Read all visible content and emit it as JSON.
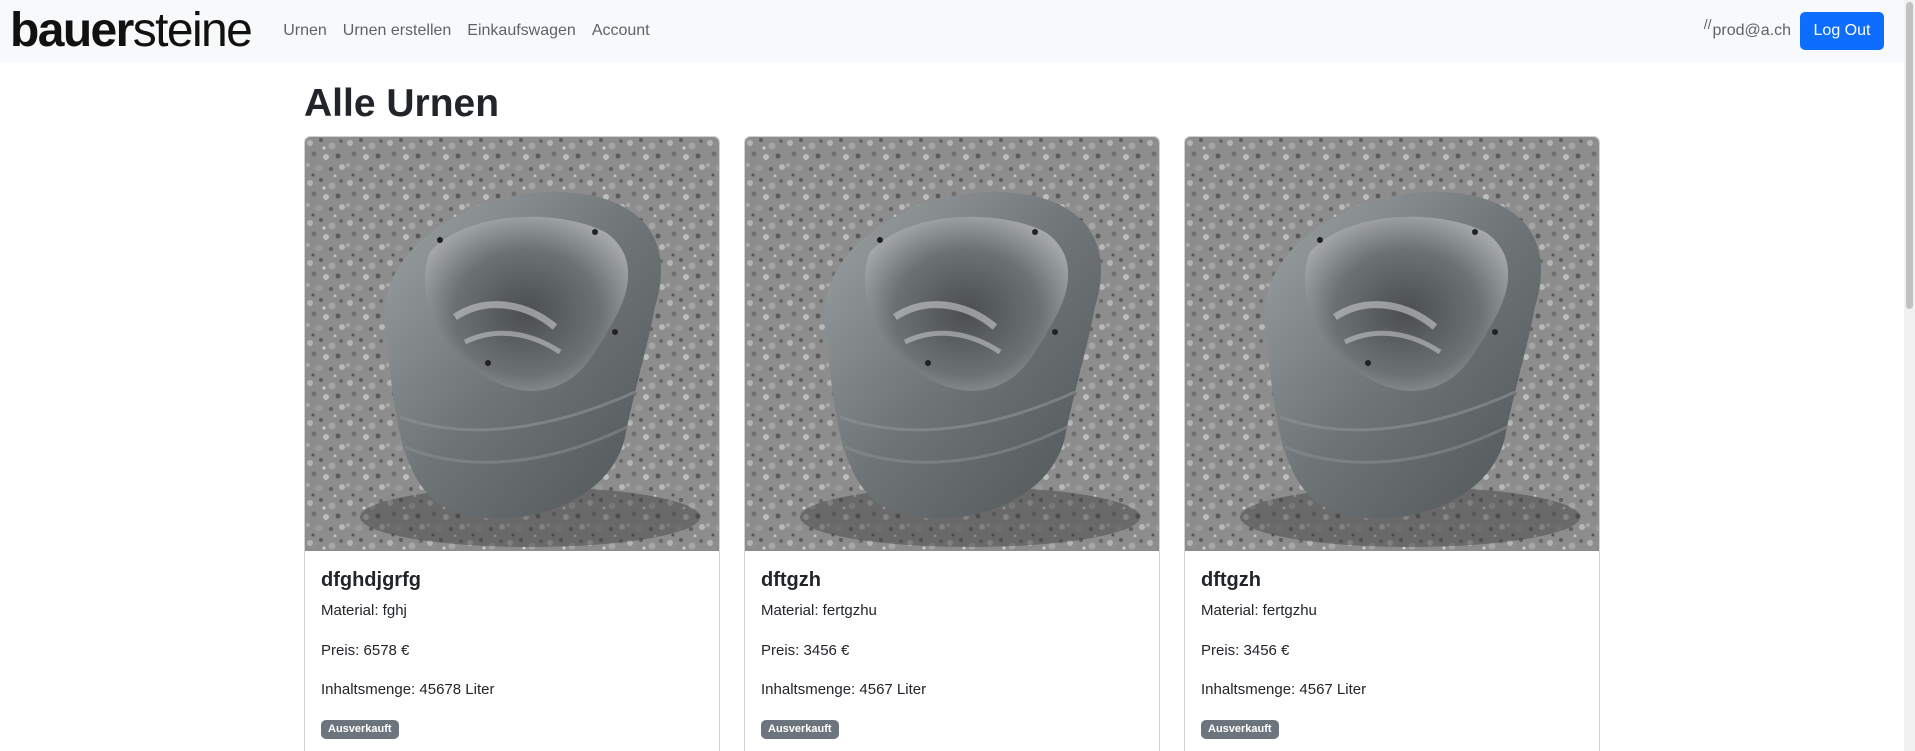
{
  "nav": {
    "brand_bold": "bauer",
    "brand_light": "steine",
    "links": [
      "Urnen",
      "Urnen erstellen",
      "Einkaufswagen",
      "Account"
    ],
    "user_glyph": "//",
    "user_email": "prod@a.ch",
    "logout_label": "Log Out"
  },
  "page": {
    "title": "Alle Urnen"
  },
  "cards": [
    {
      "title": "dfghdjgrfg",
      "material": "Material: fghj",
      "price": "Preis: 6578 €",
      "volume": "Inhaltsmenge: 45678 Liter",
      "badge": "Ausverkauft"
    },
    {
      "title": "dftgzh",
      "material": "Material: fertgzhu",
      "price": "Preis: 3456 €",
      "volume": "Inhaltsmenge: 4567 Liter",
      "badge": "Ausverkauft"
    },
    {
      "title": "dftgzh",
      "material": "Material: fertgzhu",
      "price": "Preis: 3456 €",
      "volume": "Inhaltsmenge: 4567 Liter",
      "badge": "Ausverkauft"
    }
  ],
  "colors": {
    "navbar_bg": "#f8f9fa",
    "primary": "#0d6efd",
    "badge": "#6c757d",
    "gravel": "#8a8a8a",
    "urn_stone": "#7f8487"
  },
  "icons": {
    "urn_image": "stone-urn-on-gravel-image"
  }
}
